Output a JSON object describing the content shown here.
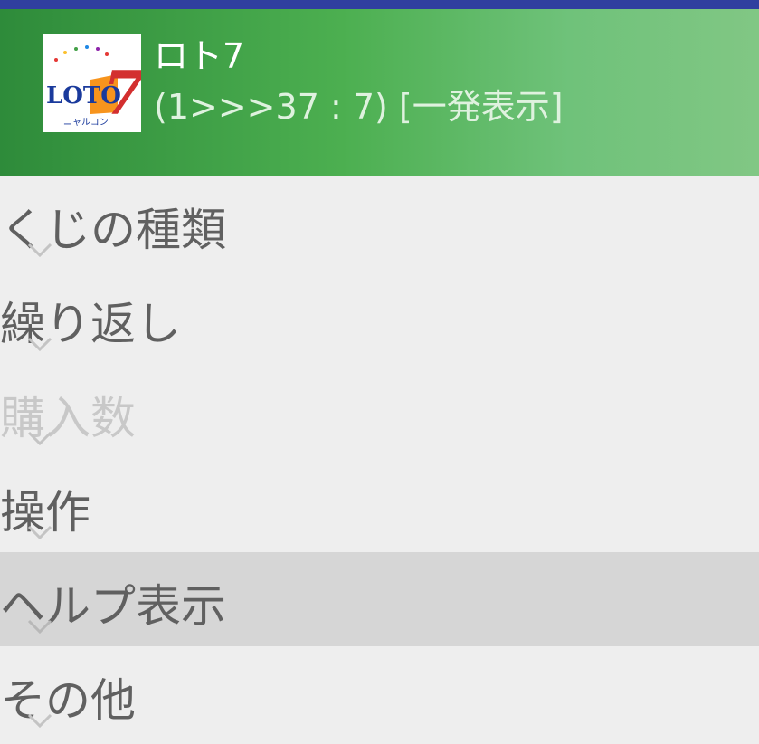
{
  "header": {
    "title": "ロト7",
    "subtitle": "(1>>>37 : 7) [一発表示]",
    "logo": {
      "icon": "loto7-logo-icon",
      "text": "LOTO",
      "number": "7",
      "caption": "ニャルコン"
    }
  },
  "colors": {
    "status_bar": "#303f9f",
    "header_start": "#2e8b3a",
    "header_end": "#81c784",
    "background": "#eeeeee",
    "selected_row": "#d6d6d6",
    "menu_text": "#606060",
    "disabled_text": "#c8c8c8"
  },
  "menu": {
    "items": [
      {
        "label": "くじの種類",
        "icon": "chevron-down-icon",
        "state": "normal"
      },
      {
        "label": "繰り返し",
        "icon": "chevron-down-icon",
        "state": "normal"
      },
      {
        "label": "購入数",
        "icon": "chevron-down-icon",
        "state": "disabled"
      },
      {
        "label": "操作",
        "icon": "chevron-down-icon",
        "state": "normal"
      },
      {
        "label": "ヘルプ表示",
        "icon": "chevron-down-icon",
        "state": "selected"
      },
      {
        "label": "その他",
        "icon": "chevron-down-icon",
        "state": "normal"
      }
    ]
  }
}
